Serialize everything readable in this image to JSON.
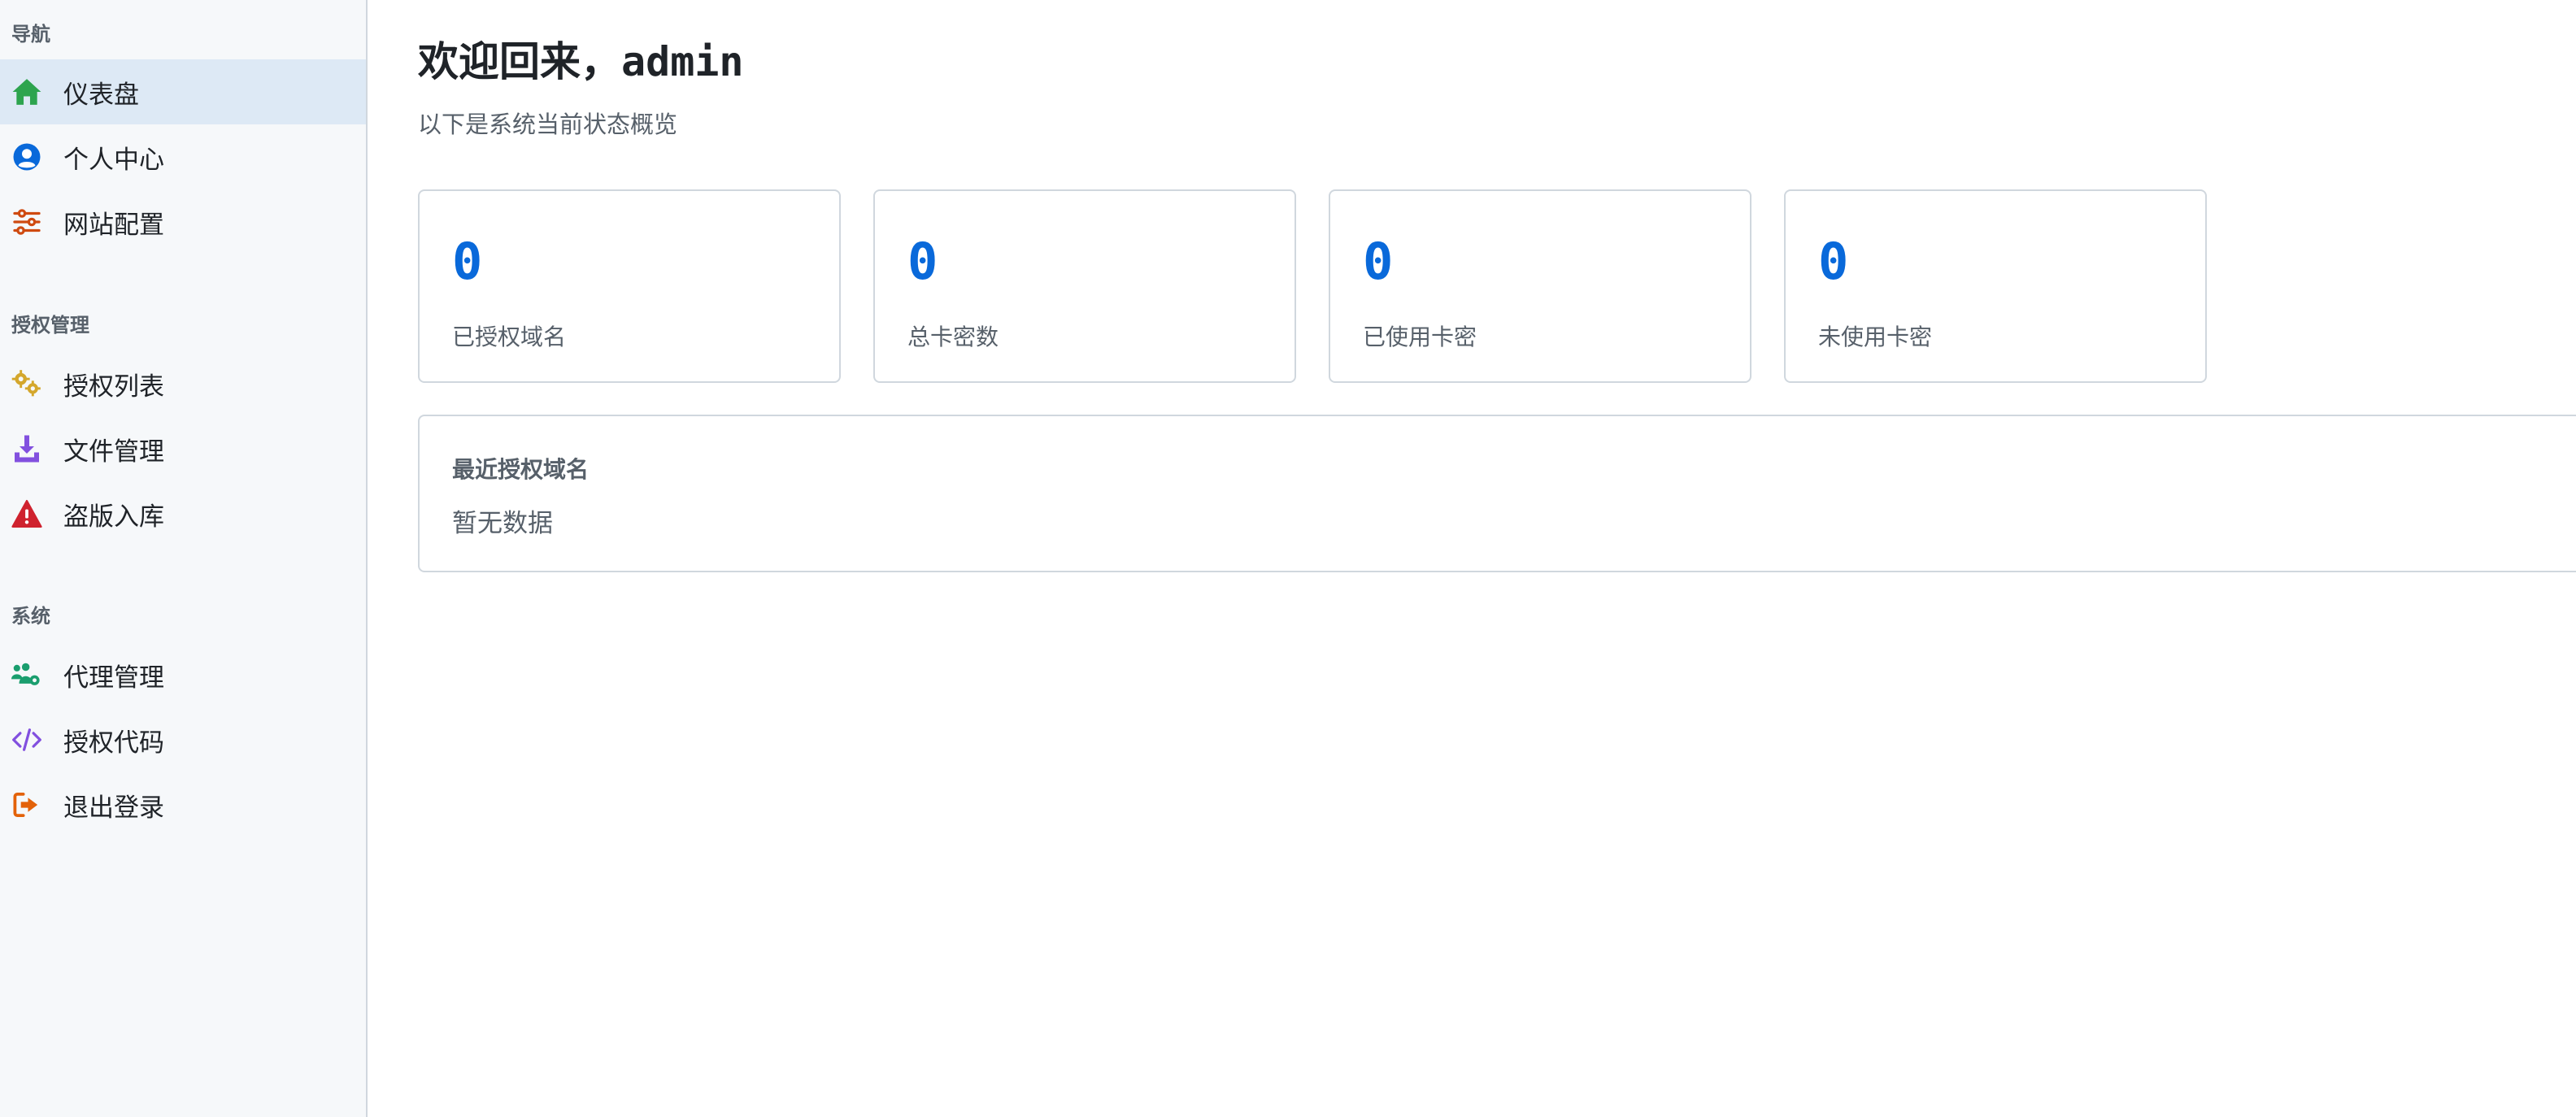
{
  "sidebar": {
    "sections": [
      {
        "title": "导航",
        "items": [
          {
            "label": "仪表盘",
            "icon": "home-icon",
            "color": "#2da44e",
            "active": true
          },
          {
            "label": "个人中心",
            "icon": "user-circle-icon",
            "color": "#0969da"
          },
          {
            "label": "网站配置",
            "icon": "sliders-icon",
            "color": "#cf4a10"
          }
        ]
      },
      {
        "title": "授权管理",
        "items": [
          {
            "label": "授权列表",
            "icon": "gears-icon",
            "color": "#d4a72c"
          },
          {
            "label": "文件管理",
            "icon": "download-icon",
            "color": "#8250df"
          },
          {
            "label": "盗版入库",
            "icon": "warning-icon",
            "color": "#cf222e"
          }
        ]
      },
      {
        "title": "系统",
        "items": [
          {
            "label": "代理管理",
            "icon": "users-gear-icon",
            "color": "#1a9e6e"
          },
          {
            "label": "授权代码",
            "icon": "code-icon",
            "color": "#8250df"
          },
          {
            "label": "退出登录",
            "icon": "logout-icon",
            "color": "#e36209"
          }
        ]
      }
    ]
  },
  "main": {
    "title": "欢迎回来，admin",
    "subtitle": "以下是系统当前状态概览",
    "stats": [
      {
        "value": "0",
        "label": "已授权域名"
      },
      {
        "value": "0",
        "label": "总卡密数"
      },
      {
        "value": "0",
        "label": "已使用卡密"
      },
      {
        "value": "0",
        "label": "未使用卡密"
      }
    ],
    "recent": {
      "title": "最近授权域名",
      "empty_text": "暂无数据"
    }
  },
  "colors": {
    "accent": "#0969da",
    "sidebar_bg": "#f6f8fa",
    "active_bg": "#dde9f5"
  }
}
